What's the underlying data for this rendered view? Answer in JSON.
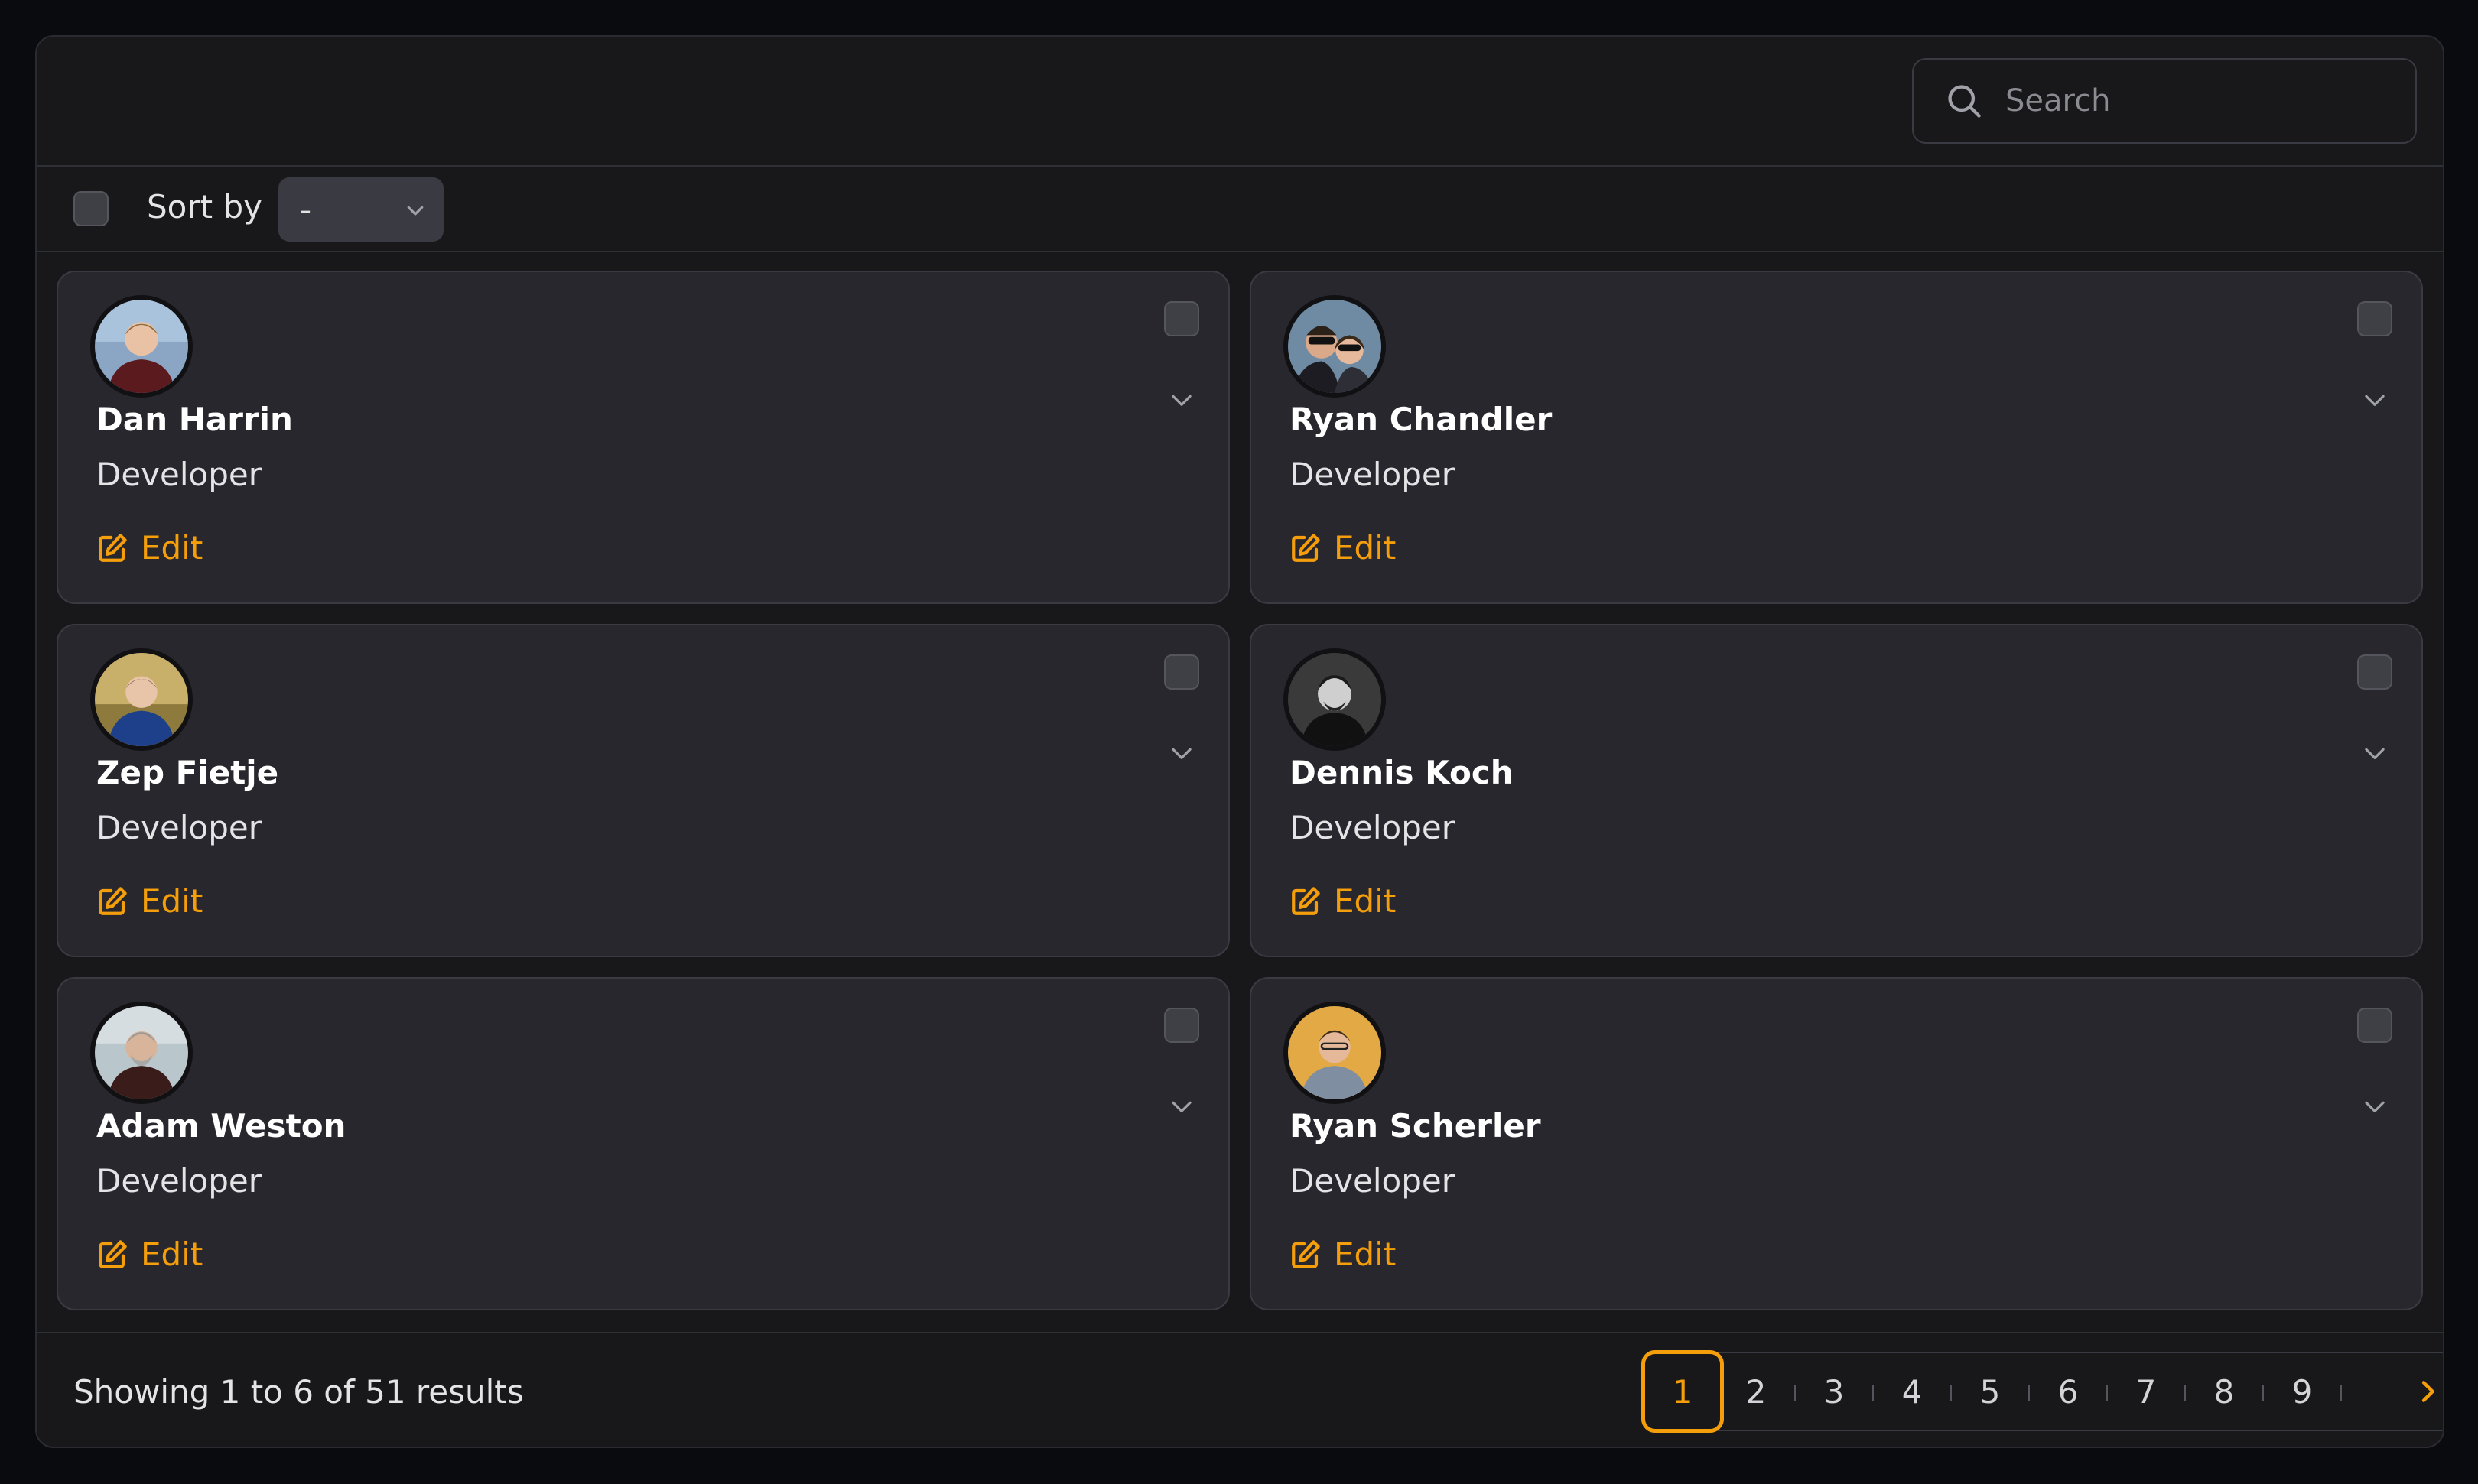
{
  "search": {
    "placeholder": "Search"
  },
  "toolbar": {
    "sort_label": "Sort by",
    "sort_value": "-"
  },
  "cards": [
    {
      "name": "Dan Harrin",
      "role": "Developer",
      "edit": "Edit"
    },
    {
      "name": "Ryan Chandler",
      "role": "Developer",
      "edit": "Edit"
    },
    {
      "name": "Zep Fietje",
      "role": "Developer",
      "edit": "Edit"
    },
    {
      "name": "Dennis Koch",
      "role": "Developer",
      "edit": "Edit"
    },
    {
      "name": "Adam Weston",
      "role": "Developer",
      "edit": "Edit"
    },
    {
      "name": "Ryan Scherler",
      "role": "Developer",
      "edit": "Edit"
    }
  ],
  "footer": {
    "results_text": "Showing 1 to 6 of 51 results"
  },
  "pagination": {
    "pages": [
      "1",
      "2",
      "3",
      "4",
      "5",
      "6",
      "7",
      "8",
      "9"
    ],
    "active": "1"
  },
  "colors": {
    "accent": "#f59e0b",
    "background": "#18181b",
    "card": "#27272d"
  }
}
